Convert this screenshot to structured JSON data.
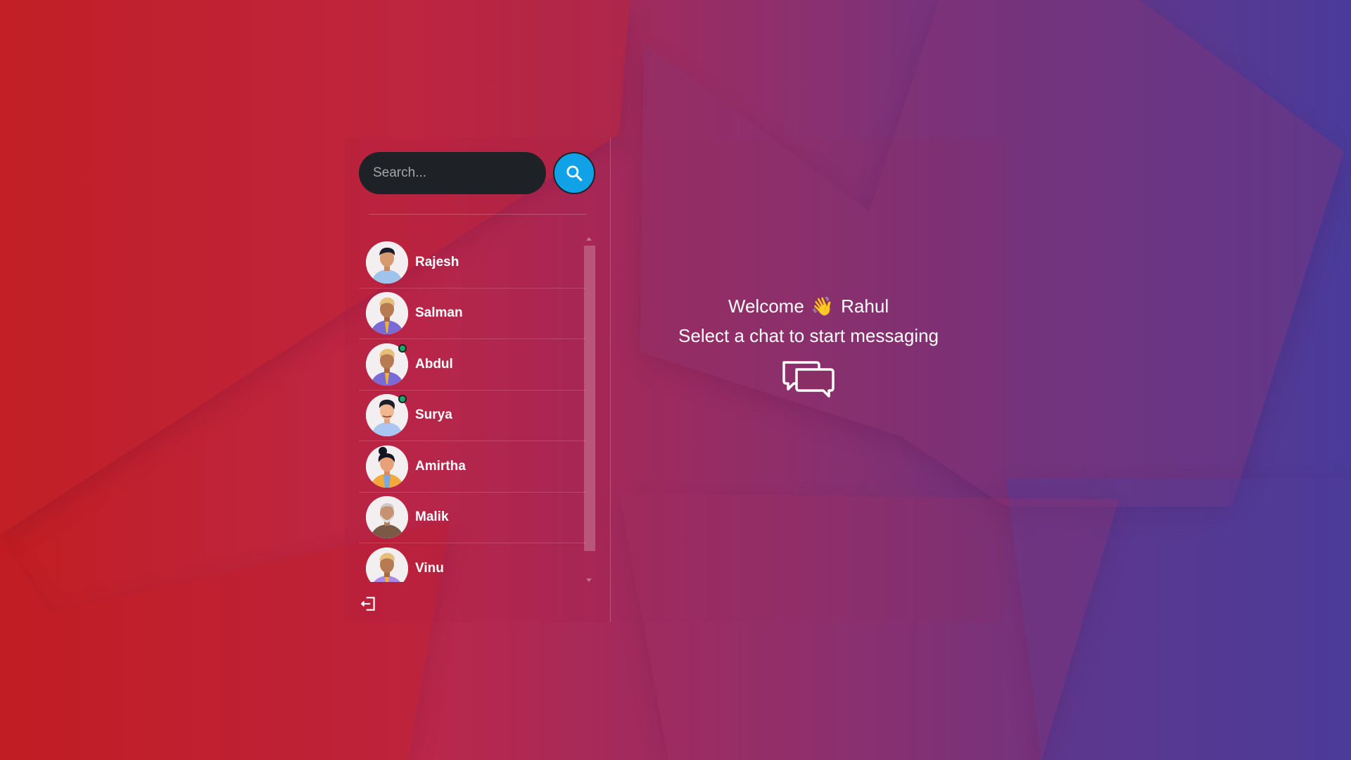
{
  "search": {
    "placeholder": "Search..."
  },
  "chats": [
    {
      "name": "Rajesh",
      "online": false,
      "avatar": "avatar-rajesh"
    },
    {
      "name": "Salman",
      "online": false,
      "avatar": "avatar-salman"
    },
    {
      "name": "Abdul",
      "online": true,
      "avatar": "avatar-abdul"
    },
    {
      "name": "Surya",
      "online": true,
      "avatar": "avatar-surya"
    },
    {
      "name": "Amirtha",
      "online": false,
      "avatar": "avatar-amirtha"
    },
    {
      "name": "Malik",
      "online": false,
      "avatar": "avatar-malik"
    },
    {
      "name": "Vinu",
      "online": false,
      "avatar": "avatar-vinu"
    }
  ],
  "main": {
    "welcome_text": "Welcome",
    "wave_emoji": "👋",
    "user_name": "Rahul",
    "subtitle": "Select a chat to start messaging"
  },
  "icons": {
    "search": "search-icon",
    "logout": "logout-icon",
    "chat": "chat-bubbles-icon"
  },
  "colors": {
    "search_button": "#10a1e6",
    "search_input_bg": "#1e2227",
    "online": "#1ba86a"
  }
}
